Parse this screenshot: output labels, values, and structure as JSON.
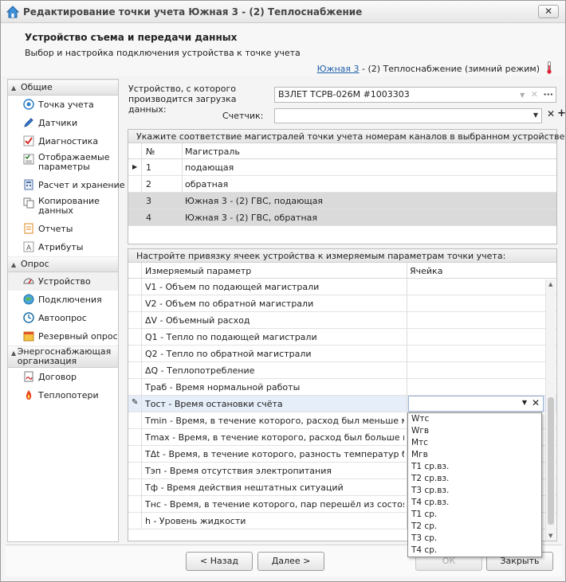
{
  "window": {
    "title": "Редактирование точки учета Южная 3 - (2) Теплоснабжение",
    "close": "✕"
  },
  "header": {
    "title": "Устройство съема и передачи данных",
    "subtitle": "Выбор и настройка подключения устройства к точке учета",
    "breadcrumb_link": "Южная 3",
    "breadcrumb_rest": " - (2) Теплоснабжение (зимний режим)"
  },
  "nav": {
    "groups": [
      {
        "label": "Общие",
        "items": [
          {
            "label": "Точка учета",
            "icon": "target-icon"
          },
          {
            "label": "Датчики",
            "icon": "pen-icon"
          },
          {
            "label": "Диагностика",
            "icon": "check-icon"
          },
          {
            "label": "Отображаемые параметры",
            "icon": "checklist-icon"
          },
          {
            "label": "Расчет и хранение",
            "icon": "calc-icon"
          },
          {
            "label": "Копирование данных",
            "icon": "copy-icon"
          },
          {
            "label": "Отчеты",
            "icon": "report-icon"
          },
          {
            "label": "Атрибуты",
            "icon": "attribute-icon"
          }
        ]
      },
      {
        "label": "Опрос",
        "items": [
          {
            "label": "Устройство",
            "icon": "gauge-icon"
          },
          {
            "label": "Подключения",
            "icon": "globe-icon"
          },
          {
            "label": "Автоопрос",
            "icon": "clock-icon"
          },
          {
            "label": "Резервный опрос",
            "icon": "note-icon"
          }
        ]
      },
      {
        "label": "Энергоснабжающая организация",
        "items": [
          {
            "label": "Договор",
            "icon": "contract-icon"
          },
          {
            "label": "Теплопотери",
            "icon": "fire-icon"
          }
        ]
      }
    ]
  },
  "device": {
    "label": "Устройство, с которого производится загрузка данных:",
    "value": "ВЗЛЕТ ТСРВ-026М #1003303",
    "meter_label": "Счетчик:",
    "meter_value": ""
  },
  "grid1": {
    "caption": "Укажите соответствие магистралей точки учета номерам каналов в выбранном устройстве:",
    "col_num": "№",
    "col_line": "Магистраль",
    "rows": [
      {
        "num": "1",
        "name": "подающая"
      },
      {
        "num": "2",
        "name": "обратная"
      },
      {
        "num": "3",
        "name": "Южная 3 - (2) ГВС, подающая"
      },
      {
        "num": "4",
        "name": "Южная 3 - (2) ГВС, обратная"
      }
    ]
  },
  "grid2": {
    "caption": "Настройте привязку ячеек устройства к измеряемым параметрам точки учета:",
    "col_param": "Измеряемый параметр",
    "col_cell": "Ячейка",
    "rows": [
      "V1 - Объем по подающей магистрали",
      "V2 - Объем по обратной магистрали",
      "ΔV - Объемный расход",
      "Q1 - Тепло по подающей магистрали",
      "Q2 - Тепло по обратной магистрали",
      "ΔQ - Теплопотребление",
      "Траб - Время нормальной работы",
      "Тост - Время остановки счёта",
      "Tmin - Время, в течение которого, расход был меньше минимального",
      "Tmax - Время, в течение которого, расход был больше максимального",
      "TΔt - Время, в течение которого, разность температур была меньше",
      "Тэп - Время отсутствия электропитания",
      "Тф - Время действия нештатных ситуаций",
      "Тнс - Время, в течение которого, пар перешёл из состояния насыщения",
      "h - Уровень жидкости"
    ]
  },
  "dropdown": [
    "Wтс",
    "Wгв",
    "Мтс",
    "Мгв",
    "Т1 ср.вз.",
    "Т2 ср.вз.",
    "Т3 ср.вз.",
    "Т4 ср.вз.",
    "Т1 ср.",
    "Т2 ср.",
    "Т3 ср.",
    "Т4 ср."
  ],
  "footer": {
    "back": "< Назад",
    "next": "Далее >",
    "ok": "ОК",
    "close": "Закрыть"
  }
}
